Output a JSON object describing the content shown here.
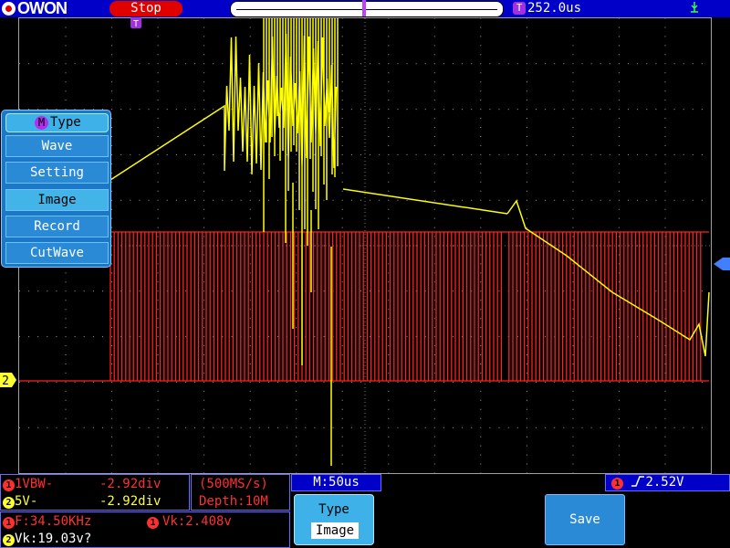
{
  "app": {
    "brand": "OWON"
  },
  "status": {
    "run_state": "Stop",
    "trigger_time": "252.0us"
  },
  "menu": {
    "title": "Type",
    "items": [
      {
        "label": "Wave",
        "selected": false
      },
      {
        "label": "Setting",
        "selected": false
      },
      {
        "label": "Image",
        "selected": true
      },
      {
        "label": "Record",
        "selected": false
      },
      {
        "label": "CutWave",
        "selected": false
      }
    ]
  },
  "channels": {
    "ch1": {
      "label": "1VBW-",
      "offset": "-2.92div",
      "color": "#ff3030"
    },
    "ch2": {
      "label": "5V-",
      "offset": "-2.92div",
      "color": "#ffff30"
    }
  },
  "acquisition": {
    "rate": "(500MS/s)",
    "depth": "Depth:10M"
  },
  "measurements": {
    "freq": "F:34.50KHz",
    "vk1": "Vk:2.408v",
    "vk2": "Vk:19.03v?"
  },
  "timebase": {
    "label": "M:50us"
  },
  "trigger": {
    "level": "2.52V"
  },
  "softkeys": {
    "type": {
      "label": "Type",
      "value": "Image"
    },
    "save": {
      "label": "Save"
    }
  },
  "colors": {
    "ch1_trace": "#ff2020",
    "ch2_trace": "#ffff00",
    "grid": "#808080",
    "menu": "#1b78c8"
  }
}
